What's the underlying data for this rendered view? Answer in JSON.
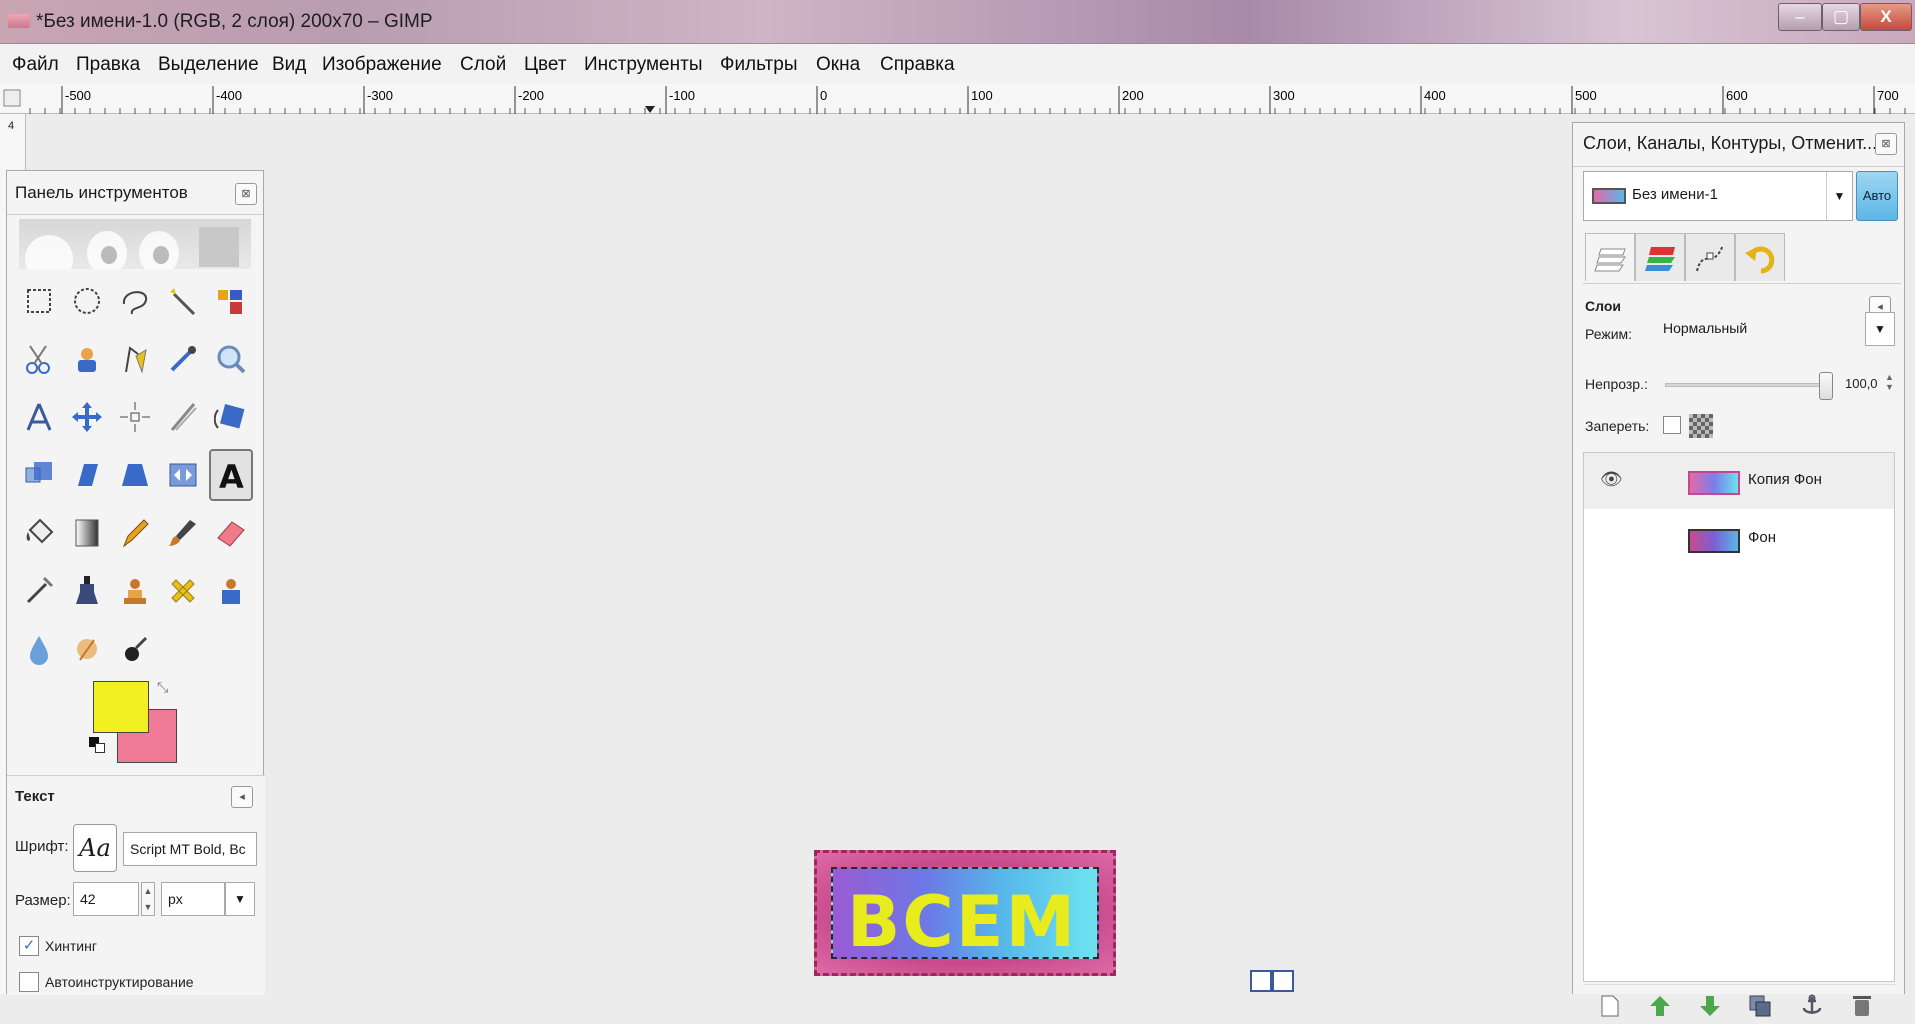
{
  "window": {
    "title": "*Без имени-1.0 (RGB, 2 слоя) 200x70 – GIMP",
    "min_label": "–",
    "max_label": "▢",
    "close_label": "X"
  },
  "menu": [
    "Файл",
    "Правка",
    "Выделение",
    "Вид",
    "Изображение",
    "Слой",
    "Цвет",
    "Инструменты",
    "Фильтры",
    "Окна",
    "Справка"
  ],
  "ruler": {
    "h_labels": [
      "-500",
      "-400",
      "-300",
      "-200",
      "-100",
      "0",
      "100",
      "200",
      "300",
      "400",
      "500",
      "600",
      "700"
    ],
    "v_label": "4"
  },
  "toolbox": {
    "title": "Панель инструментов",
    "close": "⊠",
    "tools": [
      "rect-select",
      "ellipse-select",
      "free-select",
      "fuzzy-select",
      "color-select",
      "scissors-select",
      "foreground-select",
      "paths",
      "color-picker",
      "zoom",
      "measure",
      "move",
      "align",
      "crop",
      "rotate",
      "scale",
      "shear",
      "perspective",
      "flip",
      "text",
      "bucket-fill",
      "blend",
      "pencil",
      "paintbrush",
      "eraser",
      "airbrush",
      "ink",
      "clone",
      "heal",
      "perspective-clone",
      "blur",
      "smudge",
      "dodge-burn"
    ],
    "active_tool": "text",
    "fg_color": "#f2ef22",
    "bg_color": "#f07b97"
  },
  "tool_options": {
    "heading": "Текст",
    "font_label": "Шрифт:",
    "font_glyph": "Aa",
    "font_value": "Script MT Bold, Bc",
    "size_label": "Размер:",
    "size_value": "42",
    "unit": "px",
    "hinting_label": "Хинтинг",
    "hinting_checked": true,
    "autohint_label": "Автоинструктирование",
    "autohint_checked": false
  },
  "right_dock": {
    "title": "Слои, Каналы, Контуры, Отменит...",
    "close": "⊠",
    "image_name": "Без имени-1",
    "auto_label": "Авто",
    "panel_heading": "Слои",
    "mode_label": "Режим:",
    "mode_value": "Нормальный",
    "opacity_label": "Непрозр.:",
    "opacity_value": "100,0",
    "lock_label": "Запереть:",
    "layers": [
      {
        "name": "Копия Фон",
        "visible": true,
        "selected": true
      },
      {
        "name": "Фон",
        "visible": false,
        "selected": false
      }
    ]
  },
  "canvas_image": {
    "text": "ВСЕМ"
  }
}
